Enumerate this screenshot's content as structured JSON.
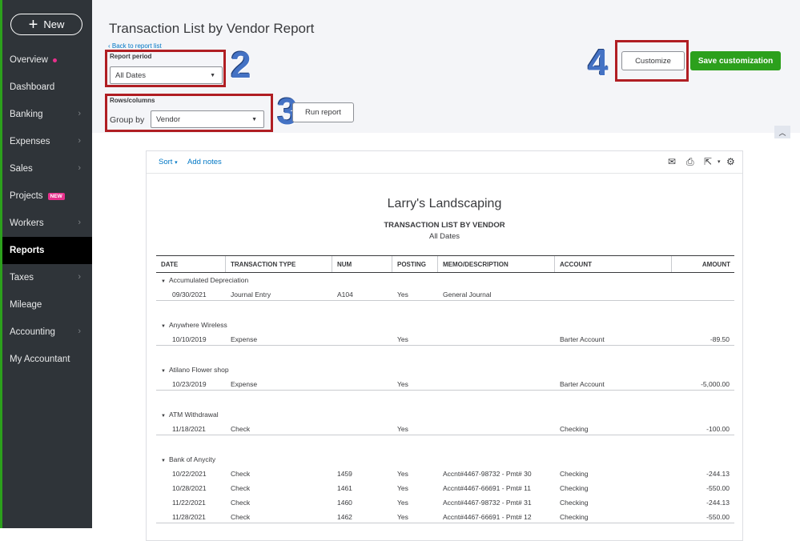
{
  "sidebar": {
    "new_label": "New",
    "items": [
      {
        "label": "Overview",
        "dot": true
      },
      {
        "label": "Dashboard"
      },
      {
        "label": "Banking",
        "chevron": true
      },
      {
        "label": "Expenses",
        "chevron": true
      },
      {
        "label": "Sales",
        "chevron": true
      },
      {
        "label": "Projects",
        "badge": "NEW"
      },
      {
        "label": "Workers",
        "chevron": true
      },
      {
        "label": "Reports",
        "active": true
      },
      {
        "label": "Taxes",
        "chevron": true
      },
      {
        "label": "Mileage"
      },
      {
        "label": "Accounting",
        "chevron": true
      },
      {
        "label": "My Accountant"
      }
    ]
  },
  "header": {
    "title": "Transaction List by Vendor Report",
    "back_link": "Back to report list",
    "report_period_label": "Report period",
    "report_period_value": "All Dates",
    "rows_columns_label": "Rows/columns",
    "group_by_label": "Group by",
    "group_by_value": "Vendor",
    "run_report": "Run report",
    "customize": "Customize",
    "save_customization": "Save customization"
  },
  "annotations": {
    "step2": "2",
    "step3": "3",
    "step4": "4"
  },
  "colors": {
    "accent_green": "#2ca01c",
    "highlight_red": "#b01e23",
    "step_blue": "#4472c4",
    "link_blue": "#0077c5"
  },
  "toolbar": {
    "sort": "Sort",
    "add_notes": "Add notes",
    "icons": [
      "email-icon",
      "print-icon",
      "export-icon",
      "settings-icon"
    ]
  },
  "report": {
    "company": "Larry's Landscaping",
    "title": "TRANSACTION LIST BY VENDOR",
    "period": "All Dates",
    "columns": [
      "DATE",
      "TRANSACTION TYPE",
      "NUM",
      "POSTING",
      "MEMO/DESCRIPTION",
      "ACCOUNT",
      "AMOUNT"
    ],
    "groups": [
      {
        "name": "Accumulated Depreciation",
        "rows": [
          {
            "date": "09/30/2021",
            "type": "Journal Entry",
            "num": "A104",
            "posting": "Yes",
            "memo": "General Journal",
            "account": "",
            "amount": ""
          }
        ]
      },
      {
        "name": "Anywhere Wireless",
        "rows": [
          {
            "date": "10/10/2019",
            "type": "Expense",
            "num": "",
            "posting": "Yes",
            "memo": "",
            "account": "Barter Account",
            "amount": "-89.50"
          }
        ]
      },
      {
        "name": "Atilano Flower shop",
        "rows": [
          {
            "date": "10/23/2019",
            "type": "Expense",
            "num": "",
            "posting": "Yes",
            "memo": "",
            "account": "Barter Account",
            "amount": "-5,000.00"
          }
        ]
      },
      {
        "name": "ATM Withdrawal",
        "rows": [
          {
            "date": "11/18/2021",
            "type": "Check",
            "num": "",
            "posting": "Yes",
            "memo": "",
            "account": "Checking",
            "amount": "-100.00"
          }
        ]
      },
      {
        "name": "Bank of Anycity",
        "rows": [
          {
            "date": "10/22/2021",
            "type": "Check",
            "num": "1459",
            "posting": "Yes",
            "memo": "Accnt#4467-98732 - Pmt# 30",
            "account": "Checking",
            "amount": "-244.13"
          },
          {
            "date": "10/28/2021",
            "type": "Check",
            "num": "1461",
            "posting": "Yes",
            "memo": "Accnt#4467-66691 - Pmt# 11",
            "account": "Checking",
            "amount": "-550.00"
          },
          {
            "date": "11/22/2021",
            "type": "Check",
            "num": "1460",
            "posting": "Yes",
            "memo": "Accnt#4467-98732 - Pmt# 31",
            "account": "Checking",
            "amount": "-244.13"
          },
          {
            "date": "11/28/2021",
            "type": "Check",
            "num": "1462",
            "posting": "Yes",
            "memo": "Accnt#4467-66691 - Pmt# 12",
            "account": "Checking",
            "amount": "-550.00"
          }
        ]
      }
    ]
  }
}
